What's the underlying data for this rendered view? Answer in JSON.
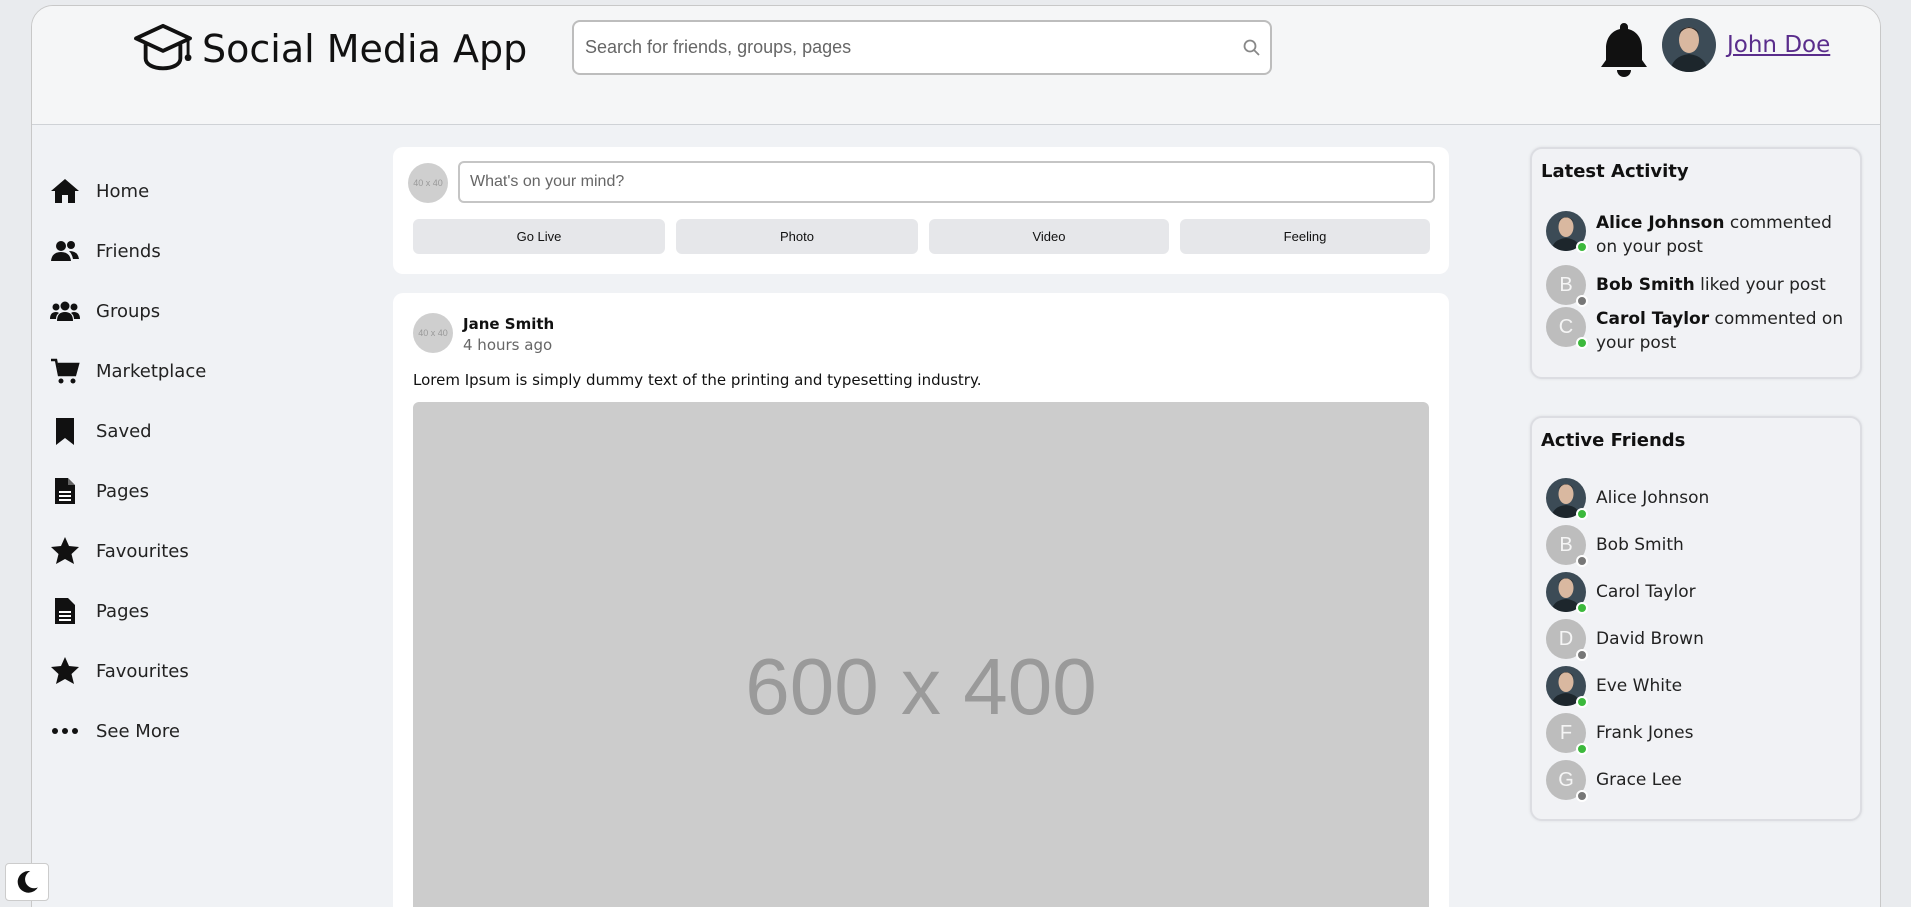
{
  "header": {
    "app_title": "Social Media App",
    "search_placeholder": "Search for friends, groups, pages",
    "user_name": "John Doe"
  },
  "sidebar": {
    "items": [
      {
        "label": "Home",
        "icon": "home-icon"
      },
      {
        "label": "Friends",
        "icon": "friends-icon"
      },
      {
        "label": "Groups",
        "icon": "groups-icon"
      },
      {
        "label": "Marketplace",
        "icon": "cart-icon"
      },
      {
        "label": "Saved",
        "icon": "bookmark-icon"
      },
      {
        "label": "Pages",
        "icon": "page-icon"
      },
      {
        "label": "Favourites",
        "icon": "star-icon"
      },
      {
        "label": "Pages",
        "icon": "page-icon"
      },
      {
        "label": "Favourites",
        "icon": "star-icon"
      },
      {
        "label": "See More",
        "icon": "more-icon"
      }
    ]
  },
  "composer": {
    "avatar_placeholder": "40 x 40",
    "placeholder": "What's on your mind?",
    "actions": [
      "Go Live",
      "Photo",
      "Video",
      "Feeling"
    ]
  },
  "post": {
    "avatar_placeholder": "40 x 40",
    "author": "Jane Smith",
    "time": "4 hours ago",
    "text": "Lorem Ipsum is simply dummy text of the printing and typesetting industry.",
    "image_placeholder": "600 x 400"
  },
  "latest_activity": {
    "title": "Latest Activity",
    "items": [
      {
        "name": "Alice Johnson",
        "action": " commented on your post",
        "avatar": "photo",
        "online": true
      },
      {
        "name": "Bob Smith",
        "action": " liked your post",
        "avatar": "B",
        "online": false
      },
      {
        "name": "Carol Taylor",
        "action": " commented on your post",
        "avatar": "C",
        "online": true
      }
    ]
  },
  "active_friends": {
    "title": "Active Friends",
    "items": [
      {
        "name": "Alice Johnson",
        "avatar": "photo",
        "online": true
      },
      {
        "name": "Bob Smith",
        "avatar": "B",
        "online": false
      },
      {
        "name": "Carol Taylor",
        "avatar": "photo",
        "online": true
      },
      {
        "name": "David Brown",
        "avatar": "D",
        "online": false
      },
      {
        "name": "Eve White",
        "avatar": "photo",
        "online": true
      },
      {
        "name": "Frank Jones",
        "avatar": "F",
        "online": true
      },
      {
        "name": "Grace Lee",
        "avatar": "G",
        "online": false
      }
    ]
  },
  "colors": {
    "online": "#3cb93c",
    "offline": "#777777",
    "link": "#5a2d8c"
  }
}
